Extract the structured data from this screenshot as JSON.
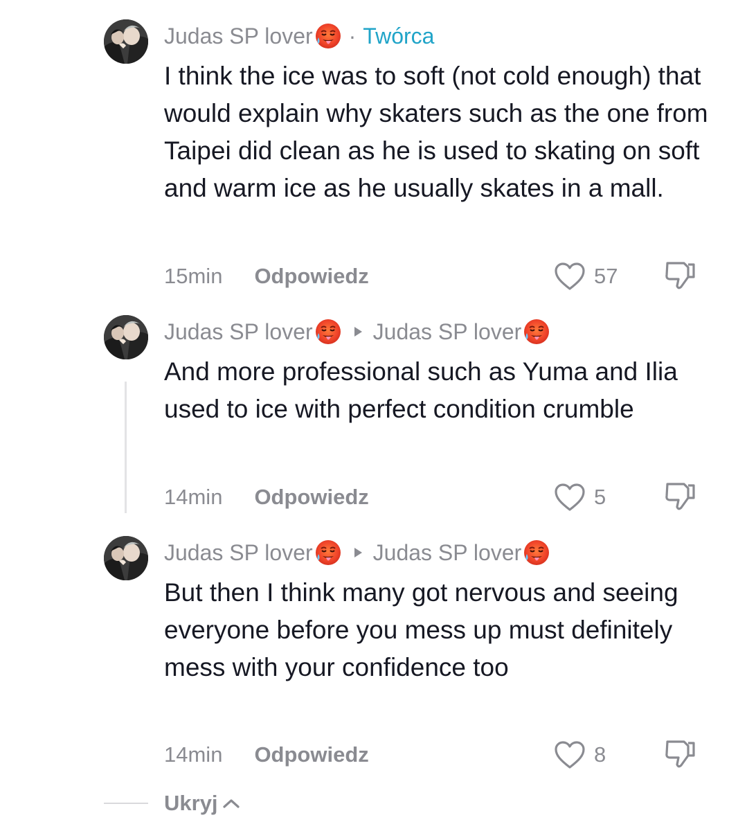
{
  "comments": [
    {
      "username": "Judas SP lover",
      "username_emoji": "hot-face-emoji",
      "badge": "Twórca",
      "text": "I think the ice was to soft (not cold enough) that would explain why skaters such as the one from Taipei did clean as he is used to skating on soft and warm ice as he usually skates in a mall.",
      "time": "15min",
      "reply_label": "Odpowiedz",
      "likes": "57"
    },
    {
      "username": "Judas SP lover",
      "reply_to": "Judas SP lover",
      "text": "And more professional such as Yuma and Ilia used to ice with perfect condition crumble",
      "time": "14min",
      "reply_label": "Odpowiedz",
      "likes": "5"
    },
    {
      "username": "Judas SP lover",
      "reply_to": "Judas SP lover",
      "text": "But then I think many got nervous and seeing everyone before you mess up must definitely mess with your confidence too",
      "time": "14min",
      "reply_label": "Odpowiedz",
      "likes": "8"
    }
  ],
  "separator_dot": "·",
  "hide_label": "Ukryj",
  "colors": {
    "text": "#161823",
    "secondary": "#8a8b91",
    "creator_badge": "#20a4c8",
    "thread_line": "#e3e3e5"
  },
  "icons": [
    "heart-outline-icon",
    "thumbs-down-icon",
    "reply-arrow-icon",
    "chevron-up-icon",
    "hot-face-emoji"
  ]
}
